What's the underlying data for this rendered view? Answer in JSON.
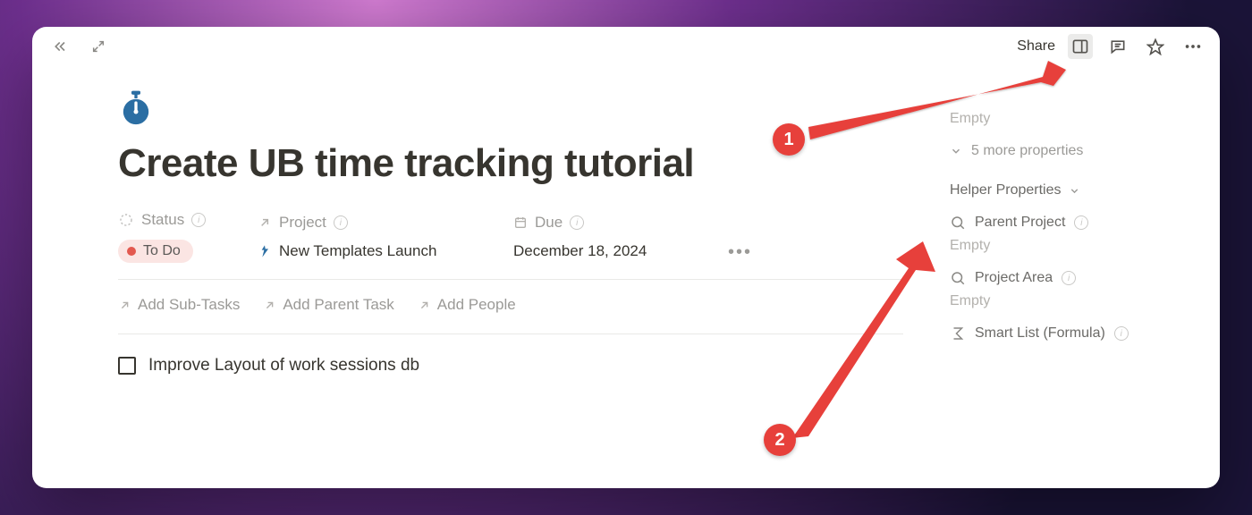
{
  "topbar": {
    "share": "Share"
  },
  "page": {
    "title": "Create UB time tracking tutorial",
    "icon": "stopwatch-icon"
  },
  "properties": {
    "status": {
      "label": "Status",
      "value": "To Do"
    },
    "project": {
      "label": "Project",
      "value": "New Templates Launch"
    },
    "due": {
      "label": "Due",
      "value": "December 18, 2024"
    }
  },
  "actions": {
    "sub": "Add Sub-Tasks",
    "parent": "Add Parent Task",
    "people": "Add People"
  },
  "todo": {
    "item": "Improve Layout of work sessions db"
  },
  "sidepanel": {
    "empty1": "Empty",
    "more": "5 more properties",
    "section": "Helper Properties",
    "parentProject": {
      "label": "Parent Project",
      "value": "Empty"
    },
    "projectArea": {
      "label": "Project Area",
      "value": "Empty"
    },
    "smartList": {
      "label": "Smart List (Formula)"
    }
  },
  "annotations": {
    "a1": "1",
    "a2": "2"
  }
}
